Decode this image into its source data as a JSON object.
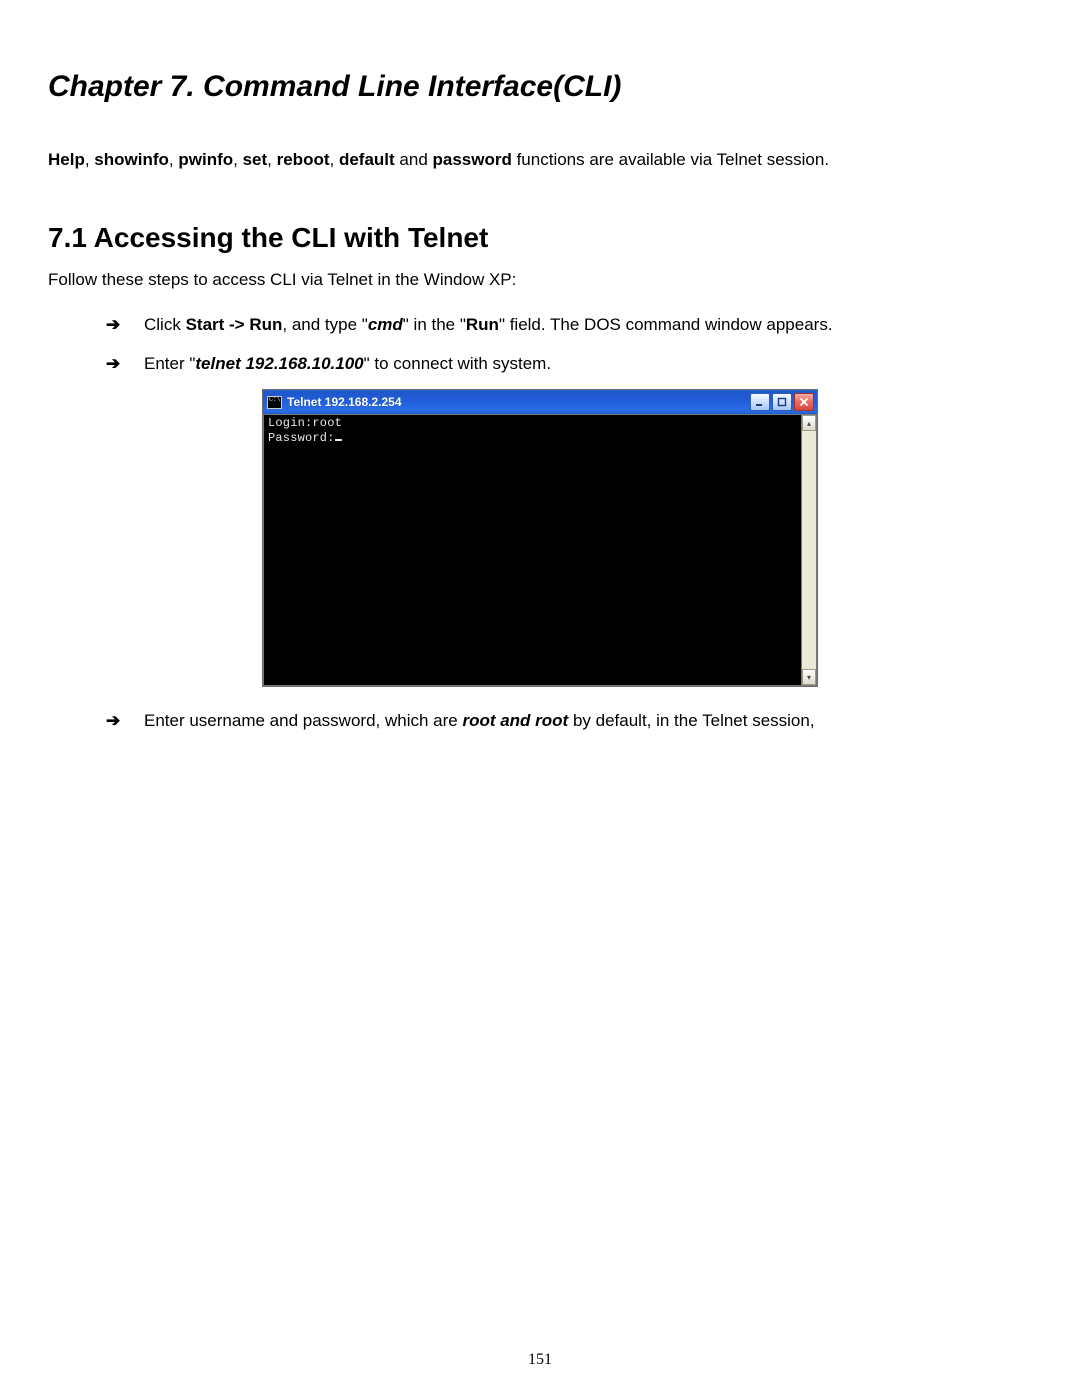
{
  "chapter": {
    "title": "Chapter 7. Command Line Interface(CLI)"
  },
  "intro": {
    "cmds": [
      "Help",
      "showinfo",
      "pwinfo",
      "set",
      "reboot",
      "default"
    ],
    "and": " and ",
    "cmd_last": "password",
    "tail": " functions are available via Telnet session."
  },
  "section": {
    "title": "7.1 Accessing the CLI with Telnet"
  },
  "lead": "Follow these steps to access CLI via Telnet in the Window XP:",
  "steps": {
    "s1": {
      "pre": "Click ",
      "b1": "Start -> Run",
      "mid1": ", and type \"",
      "bi1": "cmd",
      "mid2": "\" in the \"",
      "b2": "Run",
      "tail": "\" field. The DOS command window appears."
    },
    "s2": {
      "pre": "Enter \"",
      "bi1": "telnet 192.168.10.100",
      "tail": "\" to connect with system."
    },
    "s3": {
      "pre": "Enter username and password, which are ",
      "bi1": "root and root",
      "tail": " by default, in the Telnet session,"
    }
  },
  "telnet": {
    "title": "Telnet 192.168.2.254",
    "lines": {
      "l1": "Login:root",
      "l2": "Password:"
    },
    "buttons": {
      "min": "_",
      "max": "□",
      "close": "×"
    },
    "scroll": {
      "up": "▴",
      "down": "▾"
    }
  },
  "page_number": "151"
}
